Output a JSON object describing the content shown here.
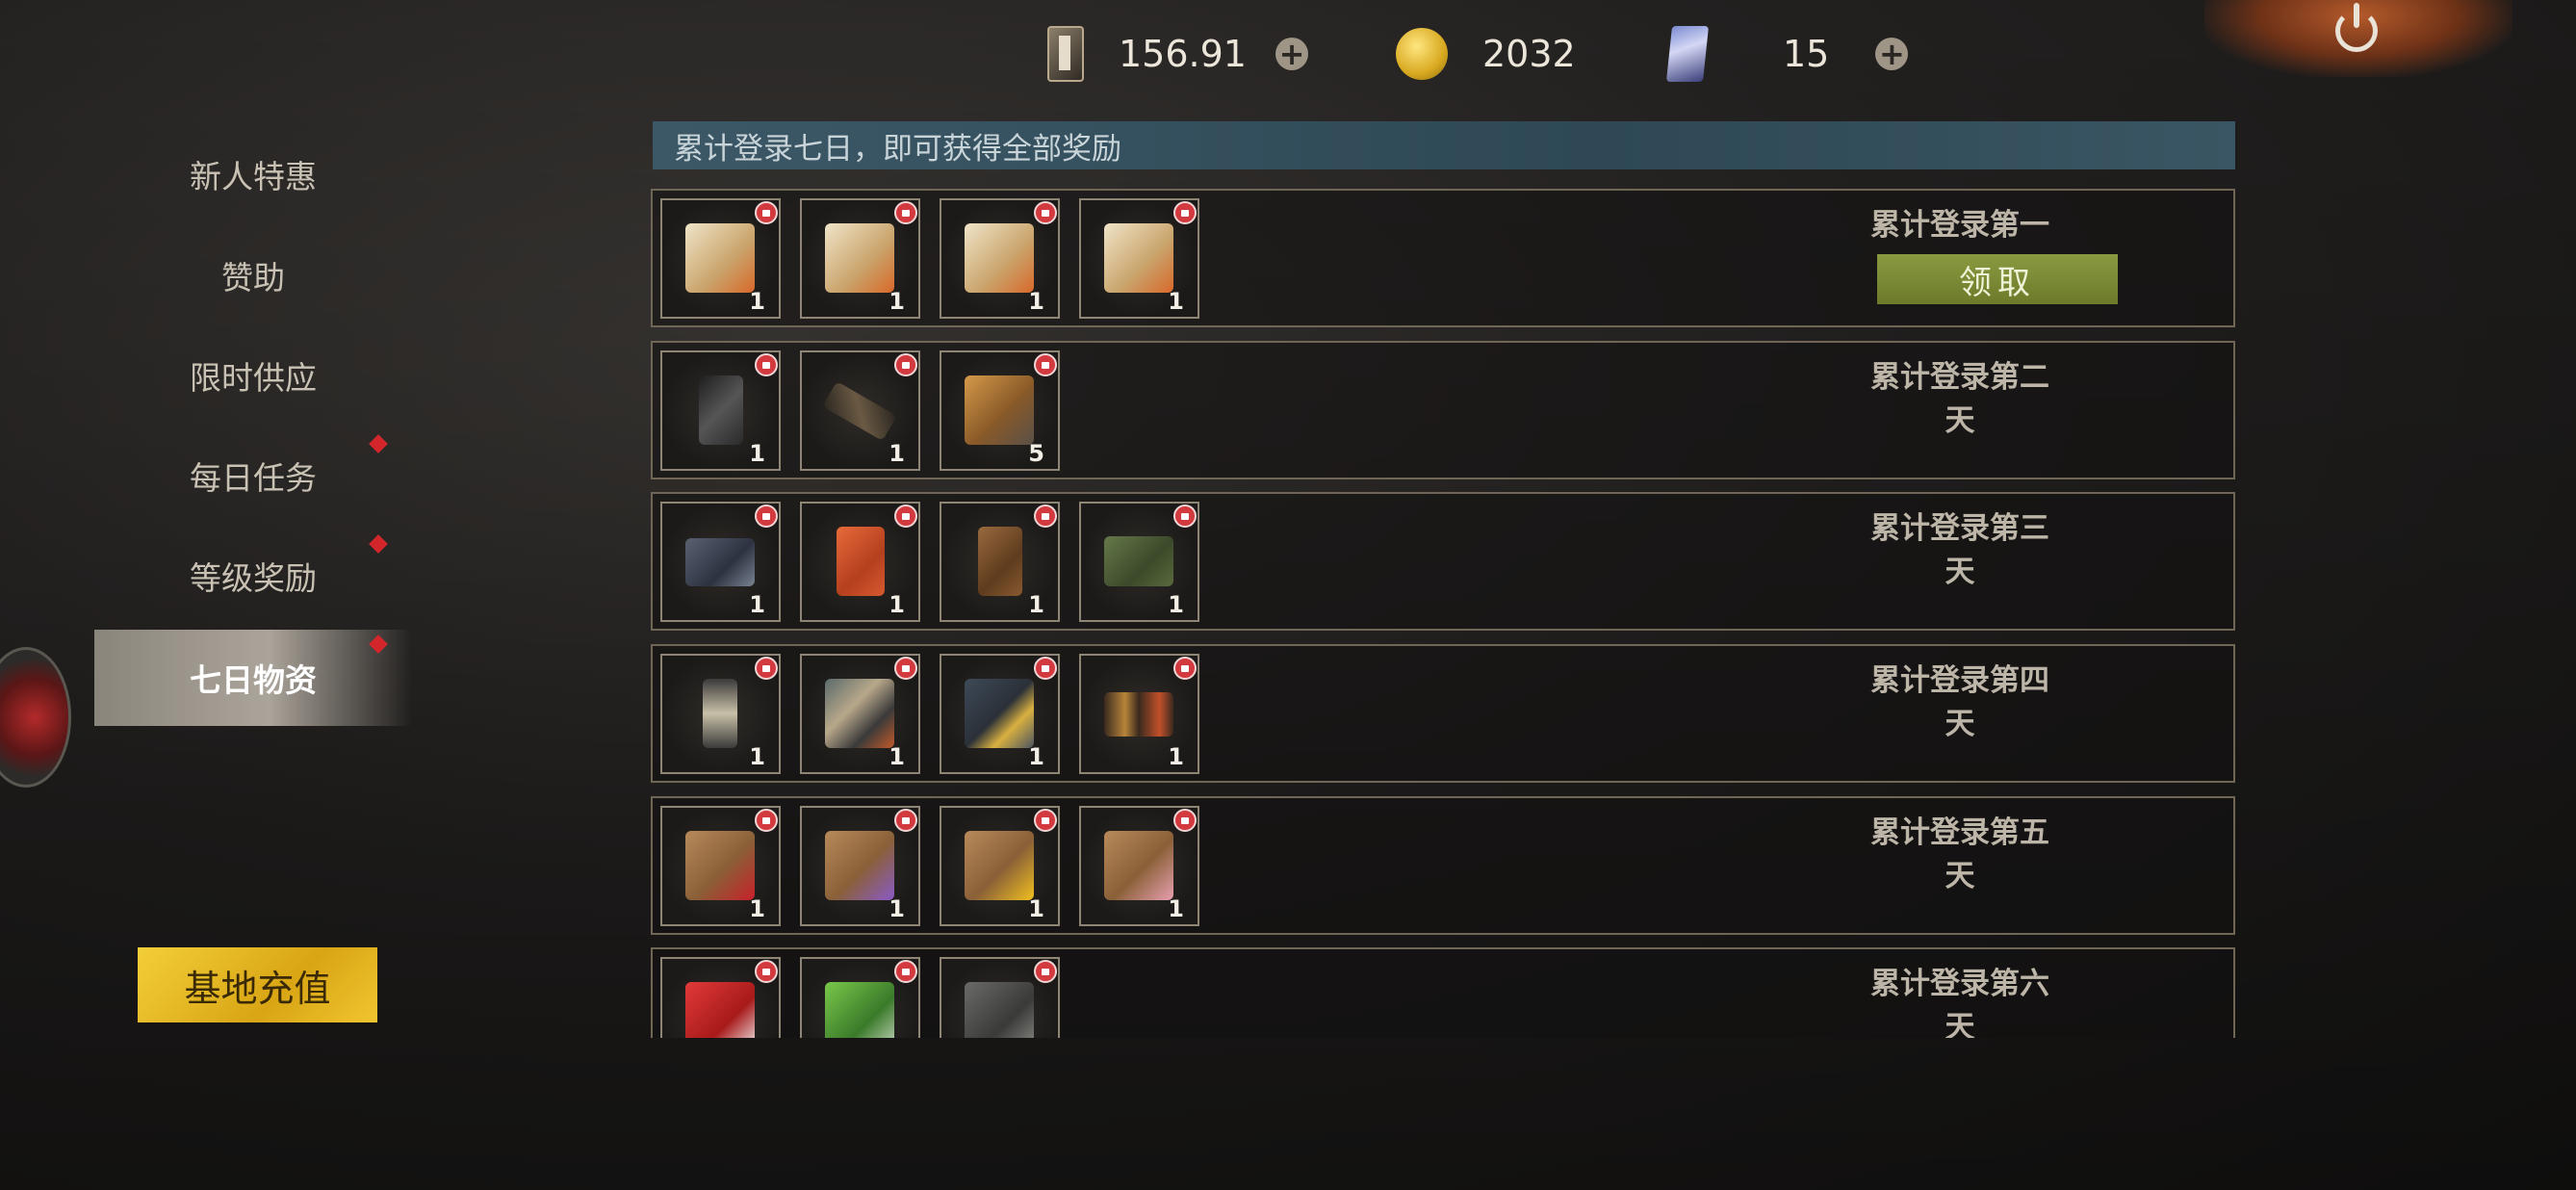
{
  "currencies": [
    {
      "icon": "card-currency-icon",
      "value": "156.91",
      "has_plus": true
    },
    {
      "icon": "gold-coin-icon",
      "value": "2032",
      "has_plus": false
    },
    {
      "icon": "ticket-card-icon",
      "value": "15",
      "has_plus": true
    }
  ],
  "plus_label": "+",
  "sidebar": {
    "items": [
      {
        "label": "新人特惠",
        "dot": false,
        "active": false
      },
      {
        "label": "赞助",
        "dot": false,
        "active": false
      },
      {
        "label": "限时供应",
        "dot": false,
        "active": false
      },
      {
        "label": "每日任务",
        "dot": true,
        "active": false
      },
      {
        "label": "等级奖励",
        "dot": true,
        "active": false
      },
      {
        "label": "七日物资",
        "dot": true,
        "active": true
      }
    ],
    "recharge_label": "基地充值"
  },
  "main": {
    "banner": "累计登录七日，即可获得全部奖励",
    "claim_label": "领取",
    "days": [
      {
        "label": "累计登录第一天",
        "claimable": true,
        "items": [
          {
            "icon": "blueprint-icon",
            "count": "1"
          },
          {
            "icon": "blueprint-icon",
            "count": "1"
          },
          {
            "icon": "blueprint-icon",
            "count": "1"
          },
          {
            "icon": "blueprint-icon",
            "count": "1"
          }
        ]
      },
      {
        "label": "累计登录第二天",
        "claimable": false,
        "items": [
          {
            "icon": "pistol-icon",
            "count": "1"
          },
          {
            "icon": "rifle-icon",
            "count": "1"
          },
          {
            "icon": "ammo-icon",
            "count": "5"
          }
        ]
      },
      {
        "label": "累计登录第三天",
        "claimable": false,
        "items": [
          {
            "icon": "metal-crate-icon",
            "count": "1"
          },
          {
            "icon": "red-fridge-icon",
            "count": "1"
          },
          {
            "icon": "wooden-cabinet-icon",
            "count": "1"
          },
          {
            "icon": "military-box-icon",
            "count": "1"
          }
        ]
      },
      {
        "label": "累计登录第四天",
        "claimable": false,
        "items": [
          {
            "icon": "lantern-icon",
            "count": "1"
          },
          {
            "icon": "armor-vest-icon",
            "count": "1"
          },
          {
            "icon": "jacket-icon",
            "count": "1"
          },
          {
            "icon": "boots-icon",
            "count": "1"
          }
        ]
      },
      {
        "label": "累计登录第五天",
        "claimable": false,
        "items": [
          {
            "icon": "rose-seed-bag-icon",
            "count": "1"
          },
          {
            "icon": "lavender-seed-bag-icon",
            "count": "1"
          },
          {
            "icon": "sunflower-seed-bag-icon",
            "count": "1"
          },
          {
            "icon": "tulip-seed-bag-icon",
            "count": "1"
          }
        ]
      },
      {
        "label": "累计登录第六天",
        "claimable": false,
        "items": [
          {
            "icon": "medkit-icon",
            "count": ""
          },
          {
            "icon": "syringe-icon",
            "count": ""
          },
          {
            "icon": "toolbox-icon",
            "count": ""
          }
        ]
      }
    ]
  },
  "colors": {
    "accent_claim": "#7d8c35",
    "lock_red": "#d33a3f",
    "recharge_gold": "#e8b822",
    "banner_teal": "#34505e"
  }
}
